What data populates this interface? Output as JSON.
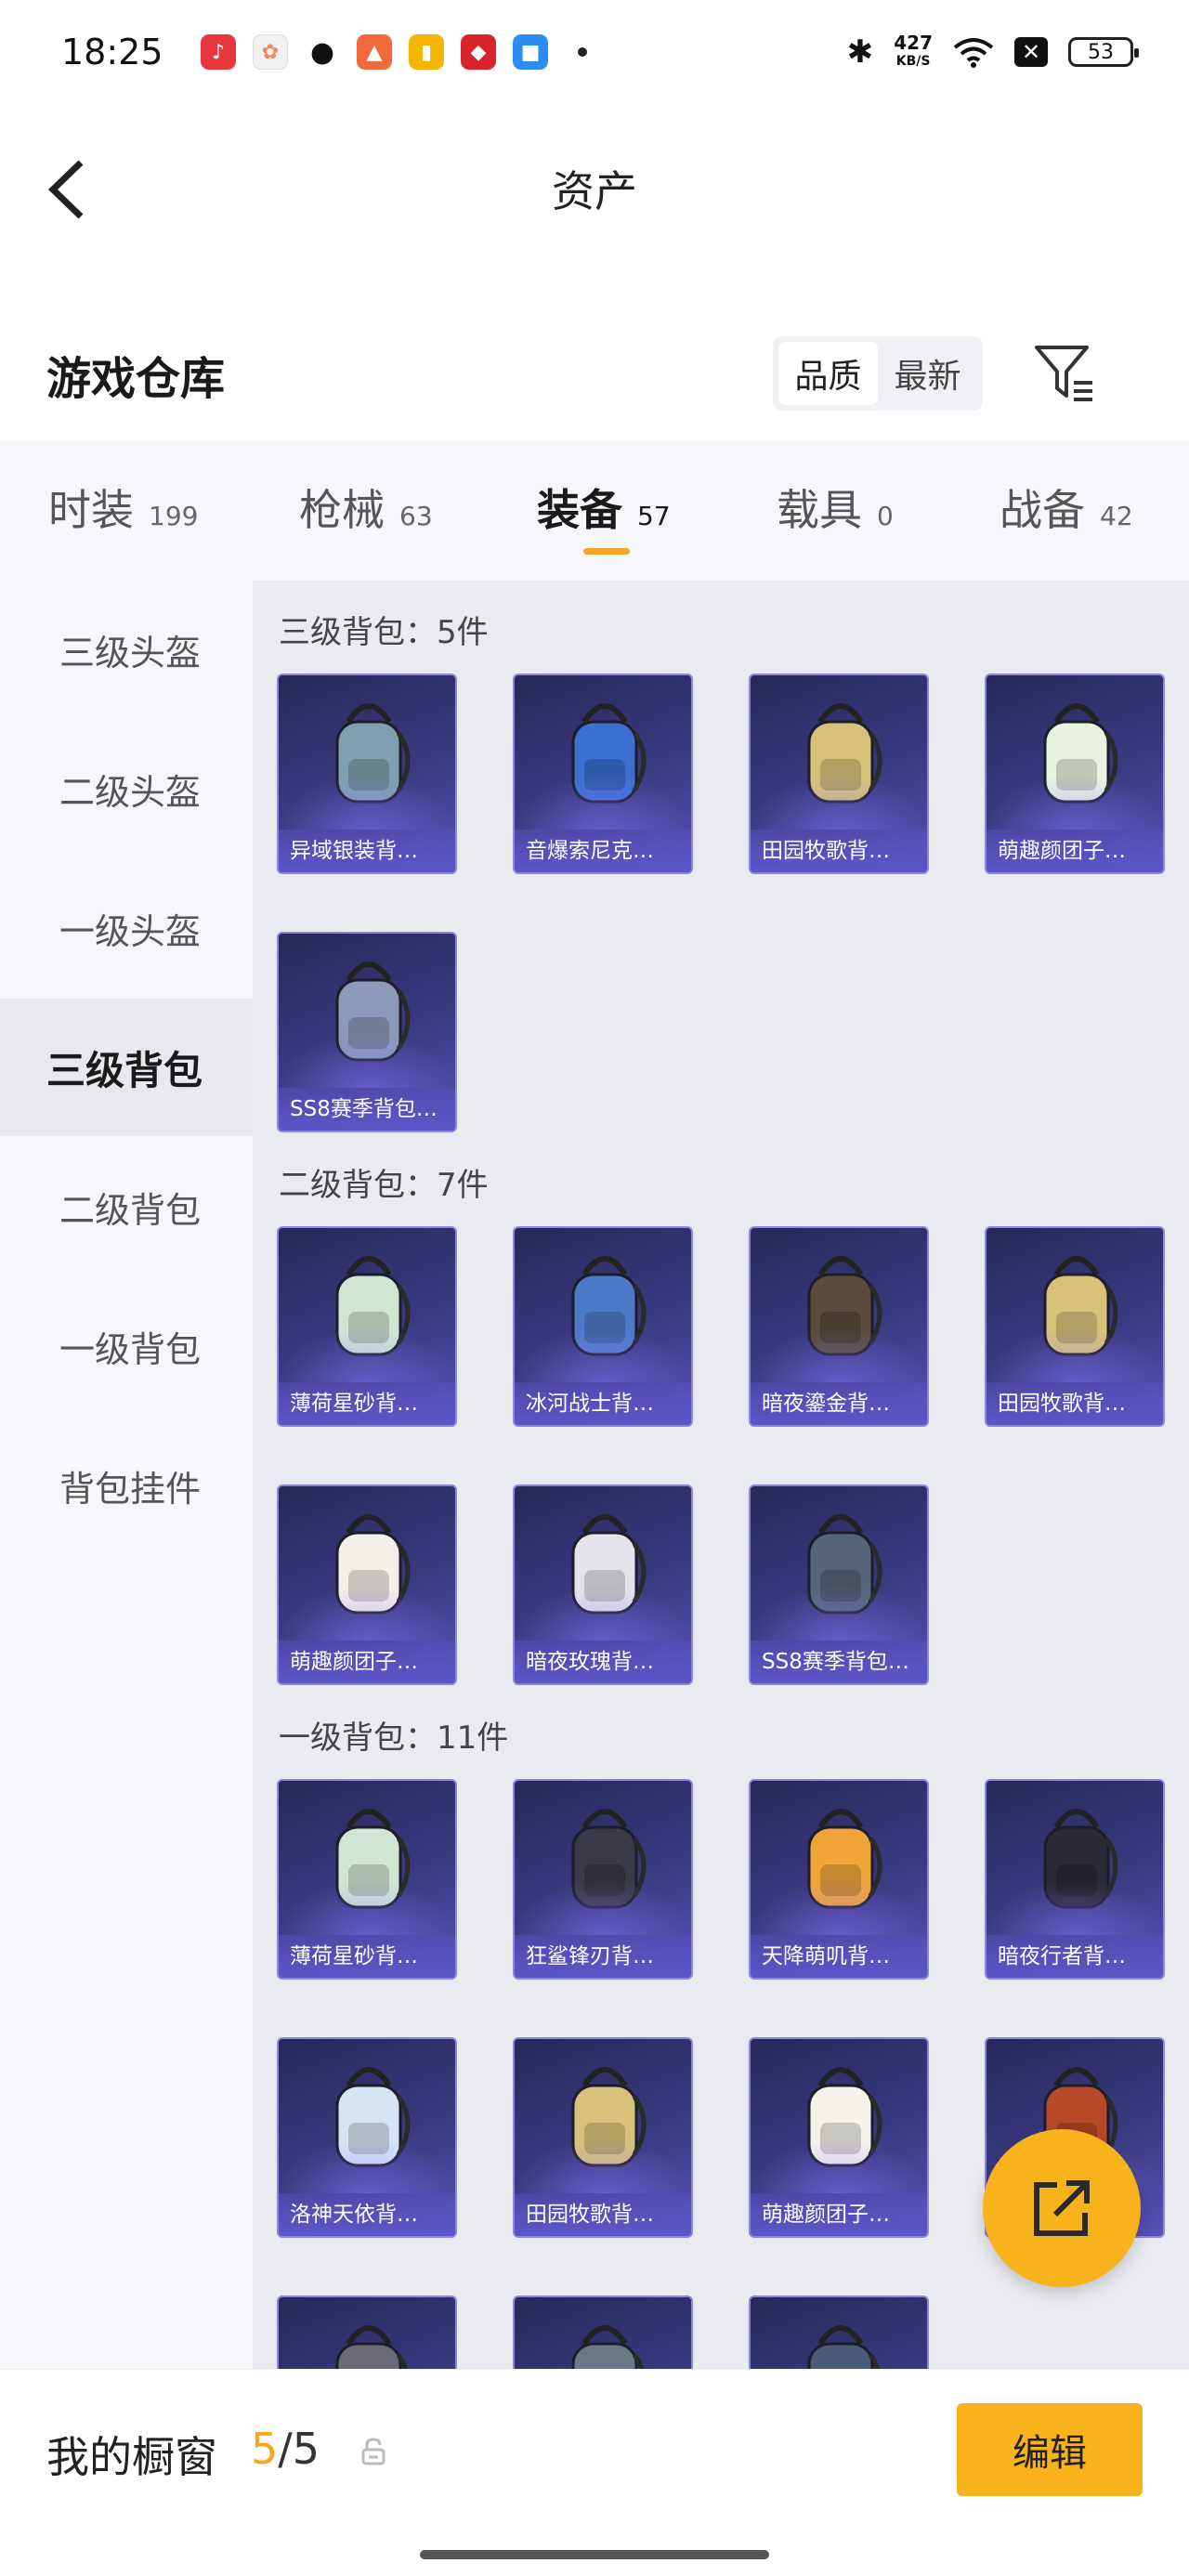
{
  "status_bar": {
    "time": "18:25",
    "speed_value": "427",
    "speed_unit": "KB/S",
    "battery": "53",
    "x_badge": "✕"
  },
  "header": {
    "title": "资产"
  },
  "warehouse": {
    "title": "游戏仓库",
    "sort_options": [
      "品质",
      "最新"
    ]
  },
  "tabs": [
    {
      "label": "时装",
      "count": "199"
    },
    {
      "label": "枪械",
      "count": "63"
    },
    {
      "label": "装备",
      "count": "57"
    },
    {
      "label": "载具",
      "count": "0"
    },
    {
      "label": "战备",
      "count": "42"
    }
  ],
  "sidebar": {
    "items": [
      "三级头盔",
      "二级头盔",
      "一级头盔",
      "三级背包",
      "二级背包",
      "一级背包",
      "背包挂件"
    ]
  },
  "sections": [
    {
      "title": "三级背包：5件",
      "items": [
        "异域银装背…",
        "音爆索尼克…",
        "田园牧歌背…",
        "萌趣颜团子…",
        "SS8赛季背包…"
      ]
    },
    {
      "title": "二级背包：7件",
      "items": [
        "薄荷星砂背…",
        "冰河战士背…",
        "暗夜鎏金背…",
        "田园牧歌背…",
        "萌趣颜团子…",
        "暗夜玫瑰背…",
        "SS8赛季背包…"
      ]
    },
    {
      "title": "一级背包：11件",
      "items": [
        "薄荷星砂背…",
        "狂鲨锋刃背…",
        "天降萌叽背…",
        "暗夜行者背…",
        "洛神天依背…",
        "田园牧歌背…",
        "萌趣颜团子…",
        "",
        "",
        "",
        ""
      ]
    }
  ],
  "bottom_bar": {
    "showcase_label": "我的橱窗",
    "showcase_current": "5",
    "showcase_sep": "/",
    "showcase_max": "5",
    "edit_label": "编辑"
  },
  "colors": {
    "accent": "#f7b21c",
    "indicator": "#f5a623",
    "card_bg": "#3b3a82"
  }
}
